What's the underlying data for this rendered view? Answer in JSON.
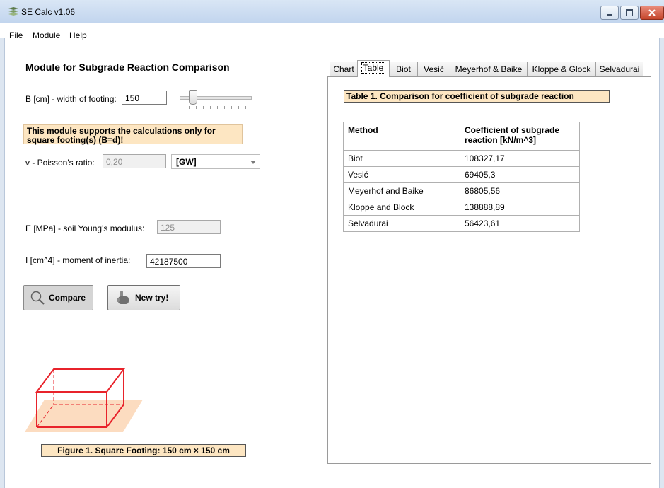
{
  "window": {
    "title": "SE Calc v1.06"
  },
  "menu": {
    "file": "File",
    "module": "Module",
    "help": "Help"
  },
  "left": {
    "heading": "Module for Subgrade Reaction Comparison",
    "b_label": "B [cm] - width of footing:",
    "b_value": "150",
    "note": "This module  supports the calculations only for square footing(s) (B=d)!",
    "nu_label": "v - Poisson's ratio:",
    "nu_value": "0,20",
    "soil_value": "[GW]",
    "e_label": "E [MPa] - soil Young's modulus:",
    "e_value": "125",
    "i_label": "I [cm^4] - moment of inertia:",
    "i_value": "42187500",
    "compare_label": "Compare",
    "newtry_label": "New try!",
    "figure_caption": "Figure 1. Square Footing: 150 cm × 150 cm"
  },
  "tabs": [
    "Chart",
    "Table",
    "Biot",
    "Vesić",
    "Meyerhof & Baike",
    "Kloppe & Glock",
    "Selvadurai"
  ],
  "table": {
    "caption": "Table 1. Comparison for coefficient of subgrade reaction",
    "headers": [
      "Method",
      "Coefficient of subgrade reaction [kN/m^3]"
    ],
    "rows": [
      [
        "Biot",
        "108327,17"
      ],
      [
        "Vesić",
        "69405,3"
      ],
      [
        "Meyerhof and Baike",
        "86805,56"
      ],
      [
        "Kloppe and Block",
        "138888,89"
      ],
      [
        "Selvadurai",
        "56423,61"
      ]
    ]
  },
  "colors": {
    "note_bg": "#fde6c2",
    "footing_red": "#e8232b",
    "ground_peach": "#fcdcc0"
  }
}
